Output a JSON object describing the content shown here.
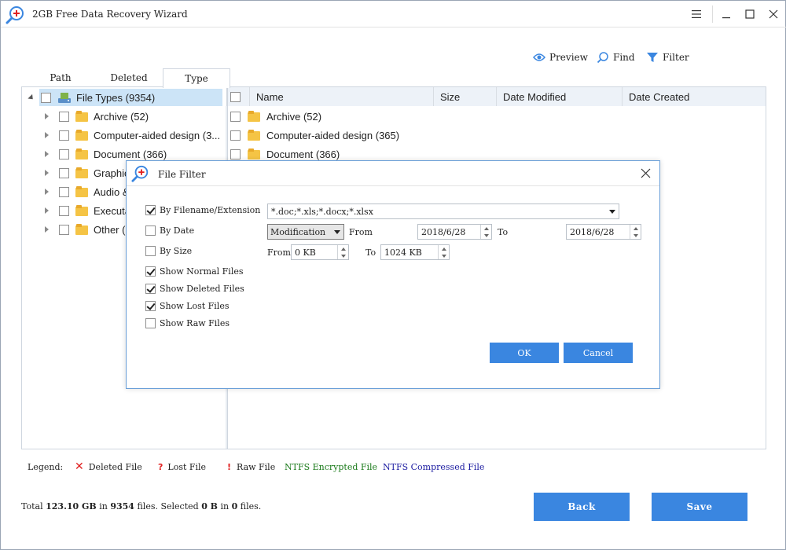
{
  "window": {
    "title": "2GB Free Data Recovery Wizard"
  },
  "toolbar": {
    "preview": "Preview",
    "find": "Find",
    "filter": "Filter"
  },
  "tabs": [
    {
      "label": "Path",
      "active": false
    },
    {
      "label": "Deleted",
      "active": false
    },
    {
      "label": "Type",
      "active": true
    }
  ],
  "tree": {
    "root": "File Types (9354)",
    "items": [
      "Archive (52)",
      "Computer-aided design (3...",
      "Document (366)",
      "Graphics",
      "Audio &",
      "Executab",
      "Other (1"
    ]
  },
  "grid": {
    "columns": [
      "Name",
      "Size",
      "Date Modified",
      "Date Created"
    ],
    "rows": [
      {
        "name": "Archive (52)"
      },
      {
        "name": "Computer-aided design (365)"
      },
      {
        "name": "Document (366)"
      }
    ]
  },
  "legend": {
    "label": "Legend:",
    "deleted": "Deleted File",
    "lost": "Lost File",
    "raw": "Raw File",
    "encrypted": "NTFS Encrypted File",
    "compressed": "NTFS Compressed File",
    "colors": {
      "deleted": "#e02020",
      "lost": "#e02020",
      "raw": "#e02020",
      "encrypted": "#1a7a1a",
      "compressed": "#1a1aa0"
    }
  },
  "footer": {
    "total_prefix": "Total",
    "total_size": "123.10 GB",
    "in1": "in",
    "total_files": "9354",
    "files_selected": "files. Selected",
    "selected_size": "0 B",
    "in2": "in",
    "selected_files": "0",
    "files_end": "files.",
    "back": "Back",
    "save": "Save"
  },
  "dialog": {
    "title": "File Filter",
    "by_filename": {
      "label": "By Filename/Extension",
      "checked": true,
      "value": "*.doc;*.xls;*.docx;*.xlsx"
    },
    "by_date": {
      "label": "By Date",
      "checked": false,
      "mode": "Modification",
      "from_label": "From",
      "from": "2018/6/28",
      "to_label": "To",
      "to": "2018/6/28"
    },
    "by_size": {
      "label": "By Size",
      "checked": false,
      "from_label": "From",
      "from": "0 KB",
      "to_label": "To",
      "to": "1024 KB"
    },
    "show_normal": {
      "label": "Show Normal Files",
      "checked": true
    },
    "show_deleted": {
      "label": "Show Deleted Files",
      "checked": true
    },
    "show_lost": {
      "label": "Show Lost Files",
      "checked": true
    },
    "show_raw": {
      "label": "Show Raw Files",
      "checked": false
    },
    "ok": "OK",
    "cancel": "Cancel"
  }
}
